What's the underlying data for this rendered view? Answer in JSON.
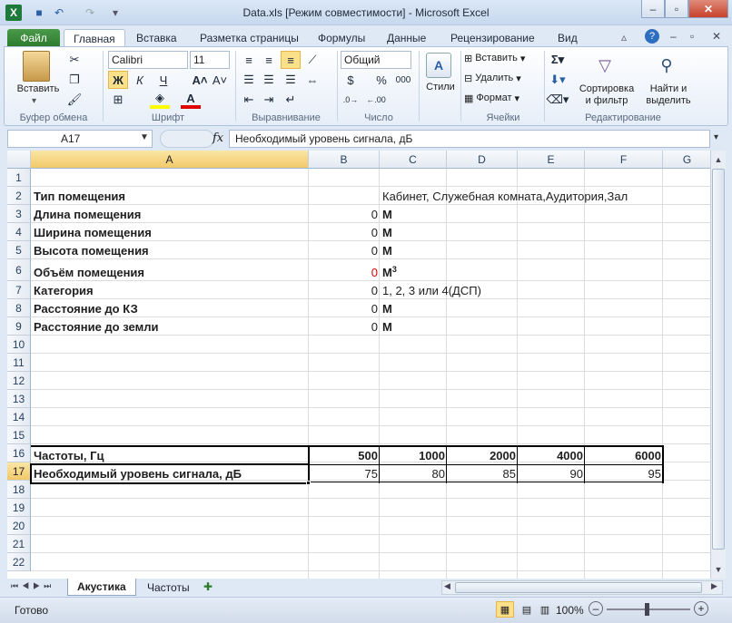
{
  "window": {
    "title": "Data.xls  [Режим совместимости]  -  Microsoft Excel"
  },
  "tabs": [
    "Файл",
    "Главная",
    "Вставка",
    "Разметка страницы",
    "Формулы",
    "Данные",
    "Рецензирование",
    "Вид"
  ],
  "ribbon": {
    "clipboard": {
      "paste_label": "Вставить",
      "group_label": "Буфер обмена"
    },
    "font": {
      "name": "Calibri",
      "size": "11",
      "bold": "Ж",
      "italic": "К",
      "underline": "Ч",
      "group_label": "Шрифт"
    },
    "alignment": {
      "group_label": "Выравнивание"
    },
    "number": {
      "format": "Общий",
      "group_label": "Число",
      "currency": "$",
      "percent": "%",
      "thousands": "000"
    },
    "styles": {
      "label": "Стили"
    },
    "cells": {
      "insert": "Вставить",
      "delete": "Удалить",
      "format": "Формат",
      "group_label": "Ячейки"
    },
    "editing": {
      "sort_line1": "Сортировка",
      "sort_line2": "и фильтр",
      "find_line1": "Найти и",
      "find_line2": "выделить",
      "group_label": "Редактирование"
    }
  },
  "formula_bar": {
    "name_box": "A17",
    "fx": "fx",
    "content": "Необходимый уровень сигнала, дБ"
  },
  "columns": [
    "A",
    "B",
    "C",
    "D",
    "E",
    "F",
    "G"
  ],
  "rows": [
    "1",
    "2",
    "3",
    "4",
    "5",
    "6",
    "7",
    "8",
    "9",
    "10",
    "11",
    "12",
    "13",
    "14",
    "15",
    "16",
    "17",
    "18",
    "19",
    "20",
    "21",
    "22"
  ],
  "cells": {
    "A2": "Тип помещения",
    "C2": "Кабинет, Служебная комната,Аудитория,Зал",
    "A3": "Длина помещения",
    "B3": "0",
    "C3": "М",
    "A4": "Ширина помещения",
    "B4": "0",
    "C4": "М",
    "A5": "Высота помещения",
    "B5": "0",
    "C5": "М",
    "A6": "Объём помещения",
    "B6": "0",
    "C6": "М",
    "C6_sup": "3",
    "A7": "Категория",
    "B7": "0",
    "C7": "1, 2, 3 или 4(ДСП)",
    "A8": "Расстояние до КЗ",
    "B8": "0",
    "C8": "М",
    "A9": "Расстояние до земли",
    "B9": "0",
    "C9": "М",
    "A16": "Частоты, Гц",
    "B16": "500",
    "C16": "1000",
    "D16": "2000",
    "E16": "4000",
    "F16": "6000",
    "A17": "Необходимый уровень сигнала, дБ",
    "B17": "75",
    "C17": "80",
    "D17": "85",
    "E17": "90",
    "F17": "95"
  },
  "colors": {
    "red_value": "#e00000"
  },
  "sheets": [
    "Акустика",
    "Частоты"
  ],
  "status": {
    "ready": "Готово",
    "zoom": "100%"
  }
}
